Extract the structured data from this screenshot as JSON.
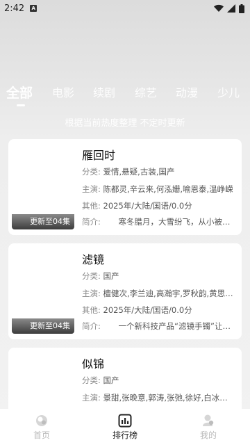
{
  "status_bar": {
    "time": "2:42",
    "notification_icon": "A"
  },
  "tabs": [
    {
      "label": "全部",
      "active": true
    },
    {
      "label": "电影",
      "active": false
    },
    {
      "label": "续剧",
      "active": false
    },
    {
      "label": "综艺",
      "active": false
    },
    {
      "label": "动漫",
      "active": false
    },
    {
      "label": "少儿",
      "active": false
    }
  ],
  "subtitle": "根据当前热度整理 不定时更新",
  "items": [
    {
      "title": "雁回时",
      "badge": "更新至04集",
      "category_label": "分类:",
      "category": "爱情,悬疑,古装,国产",
      "cast_label": "主演:",
      "cast": "陈都灵,辛云来,何泓姗,喻恩泰,温峥嵘",
      "other_label": "其他:",
      "other": "2025年/大陆/国语/0.0分",
      "intro_label": "简介:",
      "intro": "寒冬腊月，大雪纷飞，从小被…"
    },
    {
      "title": "滤镜",
      "badge": "更新至04集",
      "category_label": "分类:",
      "category": "国产",
      "cast_label": "主演:",
      "cast": "檀健次,李兰迪,高瀚宇,罗秋韵,黄思…",
      "other_label": "其他:",
      "other": "2025年/大陆/国语/0.0分",
      "intro_label": "简介:",
      "intro": "一个新科技产品“滤镜手镯”让…"
    },
    {
      "title": "似锦",
      "category_label": "分类:",
      "category": "国产",
      "cast_label": "主演:",
      "cast": "景甜,张晚意,郭涛,张弛,徐好,白冰…"
    }
  ],
  "bottom_nav": [
    {
      "label": "首页",
      "icon": "home-icon",
      "active": false
    },
    {
      "label": "排行榜",
      "icon": "ranking-icon",
      "active": true
    },
    {
      "label": "我的",
      "icon": "profile-icon",
      "active": false
    }
  ]
}
